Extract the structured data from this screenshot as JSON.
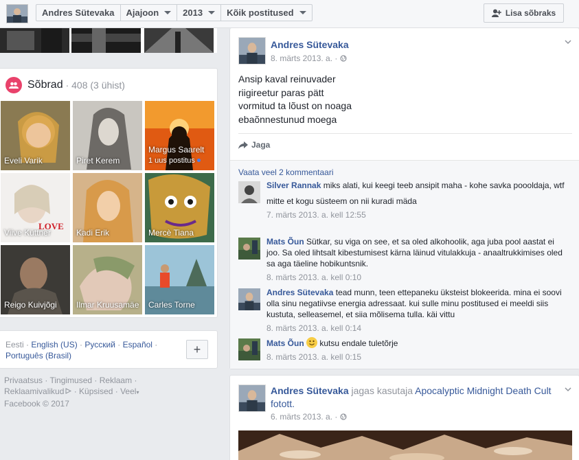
{
  "topbar": {
    "crumbs": [
      "Andres Sütevaka",
      "Ajajoon",
      "2013",
      "Kõik postitused"
    ],
    "add_friend_label": "Lisa sõbraks"
  },
  "friends": {
    "title": "Sõbrad",
    "count": "· 408 (3 ühist)",
    "tiles": [
      {
        "name": "Eveli Varik",
        "sub": ""
      },
      {
        "name": "Piret Kerem",
        "sub": ""
      },
      {
        "name": "Margus Saarelt",
        "sub": "1 uus postitus"
      },
      {
        "name": "Viive Küttner",
        "sub": ""
      },
      {
        "name": "Kadi Erik",
        "sub": ""
      },
      {
        "name": "Mercè Tiana",
        "sub": ""
      },
      {
        "name": "Reigo Kuivjõgi",
        "sub": ""
      },
      {
        "name": "Ilmar Kruusamäe",
        "sub": ""
      },
      {
        "name": "Carles Torne",
        "sub": ""
      }
    ],
    "love_text": "LOVE"
  },
  "languages": {
    "current": "Eesti",
    "links": [
      "English (US)",
      "Русский",
      "Español",
      "Português (Brasil)"
    ],
    "add_label": "+"
  },
  "footer": {
    "line1": [
      "Privaatsus",
      "Tingimused",
      "Reklaam"
    ],
    "line2": [
      "Reklaamivalikud",
      "Küpsised",
      "Veel"
    ],
    "copyright": "Facebook © 2017"
  },
  "post1": {
    "author": "Andres Sütevaka",
    "date": "8. märts 2013. a. ·",
    "text": [
      "Ansip kaval reinuvader",
      "riigireetur paras pätt",
      "vormitud ta lõust on noaga",
      "ebaõnnestunud moega"
    ],
    "share_label": "Jaga",
    "more_comments": "Vaata veel 2 kommentaari",
    "comments": [
      {
        "name": "Silver Rannak",
        "text": "miks alati, kui keegi teeb ansipit maha - kohe savka poooldaja, wtf",
        "extra": "mitte et kogu süsteem on nii kuradi mäda",
        "time": "7. märts 2013. a. kell 12:55"
      },
      {
        "name": "Mats Õun",
        "text": "Sütkar, su viga on see, et sa oled alkohoolik, aga juba pool aastat ei joo. Sa oled lihtsalt kibestumisest kärna läinud vitulakkuja - anaaltrukkimises oled sa aga täeline hobikuntsnik.",
        "extra": "",
        "time": "8. märts 2013. a. kell 0:10"
      },
      {
        "name": "Andres Sütevaka",
        "text": "tead munn, teen ettepaneku üksteist blokeerida. mina ei soovi olla sinu negatiivse energia adressaat. kui sulle minu postitused ei meeldi siis kustuta, selleasemel, et siia mõlisema tulla. käi vittu",
        "extra": "",
        "time": "8. märts 2013. a. kell 0:14"
      },
      {
        "name": "Mats Õun",
        "text": "kutsu endale tuletõrje",
        "extra": "",
        "time": "8. märts 2013. a. kell 0:15"
      }
    ]
  },
  "post2": {
    "author": "Andres Sütevaka",
    "verb": "jagas kasutaja",
    "target": "Apocalyptic Midnight Death Cult",
    "suffix": "fotott.",
    "date": "6. märts 2013. a. ·"
  },
  "colors": {
    "link": "#365899",
    "friends_icon": "#e9426b",
    "page_bg": "#e9ebee"
  }
}
